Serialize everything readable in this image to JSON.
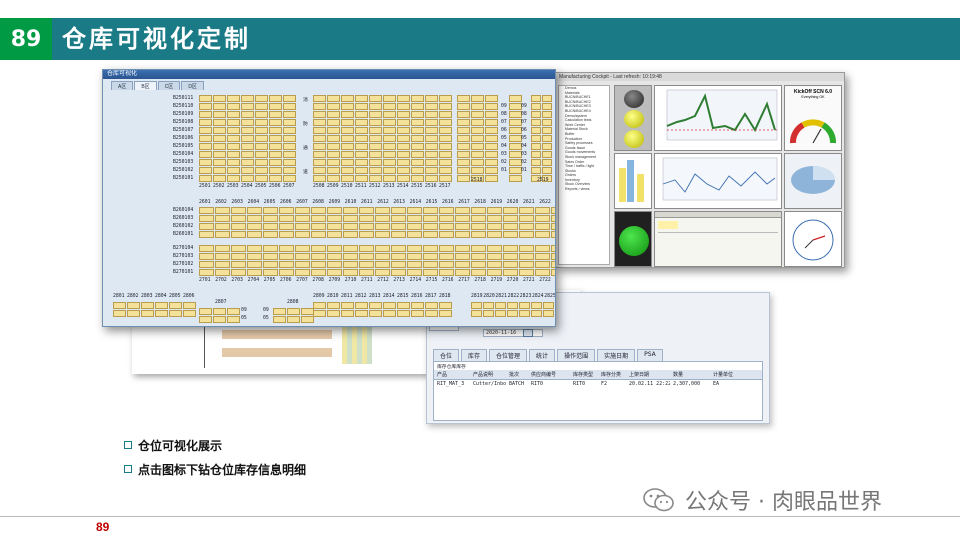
{
  "header": {
    "number": "89",
    "title": "仓库可视化定制"
  },
  "sap": {
    "window_title": "仓库可视化",
    "tabs": [
      "A区",
      "B区",
      "C区",
      "D区"
    ],
    "upper_rows": [
      "B250111",
      "B250110",
      "B250109",
      "B250108",
      "B250107",
      "B250106",
      "B250105",
      "B250104",
      "B250103",
      "B250102",
      "B250101"
    ],
    "upper_left_cols": [
      "2501",
      "2502",
      "2503",
      "2504",
      "2505",
      "2506",
      "2507"
    ],
    "upper_right_cols": [
      "2508",
      "2509",
      "2510",
      "2511",
      "2512",
      "2513",
      "2514",
      "2515",
      "2516",
      "2517"
    ],
    "aisle_chars": [
      "消",
      "防",
      "通",
      "道"
    ],
    "right_nums_a": [
      "09",
      "08",
      "07",
      "06",
      "05",
      "04",
      "03",
      "02",
      "01"
    ],
    "right_nums_b": [
      "09",
      "08",
      "07",
      "06",
      "05",
      "04",
      "03",
      "02",
      "01"
    ],
    "col_2518": "2518",
    "col_2519": "2519",
    "mid_cols": [
      "2601",
      "2602",
      "2603",
      "2604",
      "2605",
      "2606",
      "2607",
      "2608",
      "2609",
      "2610",
      "2611",
      "2612",
      "2613",
      "2614",
      "2615",
      "2616",
      "2617",
      "2618",
      "2619",
      "2620",
      "2621",
      "2622",
      "2623",
      "2624",
      "2625"
    ],
    "mid_rows": [
      "B260104",
      "B260103",
      "B260102",
      "B260101"
    ],
    "low_rows": [
      "B270104",
      "B270103",
      "B270102",
      "B270101"
    ],
    "low_cols": [
      "2701",
      "2702",
      "2703",
      "2704",
      "2705",
      "2706",
      "2707",
      "2708",
      "2709",
      "2710",
      "2711",
      "2712",
      "2713",
      "2714",
      "2715",
      "2716",
      "2717",
      "2718",
      "2719",
      "2720",
      "2721",
      "2722",
      "2723",
      "2724",
      "2725"
    ],
    "bottom_left_cols": [
      "2801",
      "2802",
      "2803",
      "2804",
      "2805",
      "2806"
    ],
    "bottom_mid_cols": [
      "2809",
      "2810",
      "2811",
      "2812",
      "2813",
      "2814",
      "2815",
      "2816",
      "2817",
      "2818"
    ],
    "bottom_right_cols": [
      "2819",
      "2820",
      "2821",
      "2822",
      "2823",
      "2824",
      "2825"
    ],
    "col_2807": "2807",
    "col_2808": "2808",
    "bottom_nums_a": [
      "09",
      "05"
    ],
    "bottom_nums_b": [
      "09",
      "05"
    ]
  },
  "dashboard": {
    "title": "Manufacturing Cockpit - Last refresh: 10:19:48",
    "gauge_title": "KickOff SCN 6.0",
    "gauge_subtitle": "Everything OK",
    "tree_items": [
      "Demos",
      "Materials",
      "BUCN/BUCHE1",
      "BUCN/BUCHE2",
      "BUCN/BUCHE3",
      "BUCN/BUCHE4",
      "Demo/system",
      "Calculation tests",
      "Work Center",
      "Material Stock",
      "Buffer",
      "Production",
      "Safety processes",
      "Goods Issue",
      "Goods movements",
      "Stock management",
      "Sales Order",
      "Time / traffic / light",
      "Stocks",
      "Orders",
      "Inventory",
      "Stock Overview",
      "Reports / views"
    ],
    "colors": {
      "ok": "#1bb31b",
      "warn": "#d8d800",
      "line": "#2e7d32",
      "blue": "#3b6fb0"
    }
  },
  "wm": {
    "tabs": [
      "仓位",
      "库存",
      "仓位管理",
      "统计",
      "操作范围",
      "实施日期",
      "PSA"
    ],
    "date_value": "2020-11-16",
    "grid_title": "库存仓库库存",
    "headers": [
      "产品",
      "产品说明",
      "批次",
      "供应商编号",
      "库存类型",
      "库存分类",
      "上架日期",
      "数量",
      "计量单位",
      "库存数量",
      "单位"
    ],
    "row": [
      "RIT_MAT_3",
      "Cutter/Inbound",
      "BATCH",
      "RIT0",
      "RIT0",
      "F2",
      "20.02.11 22:22:05",
      "2,307,000",
      "EA"
    ]
  },
  "bullets": [
    "仓位可视化展示",
    "点击图标下钻仓位库存信息明细"
  ],
  "watermark": {
    "text": "公众号 · 肉眼品世界"
  },
  "footer": {
    "page": "89"
  }
}
